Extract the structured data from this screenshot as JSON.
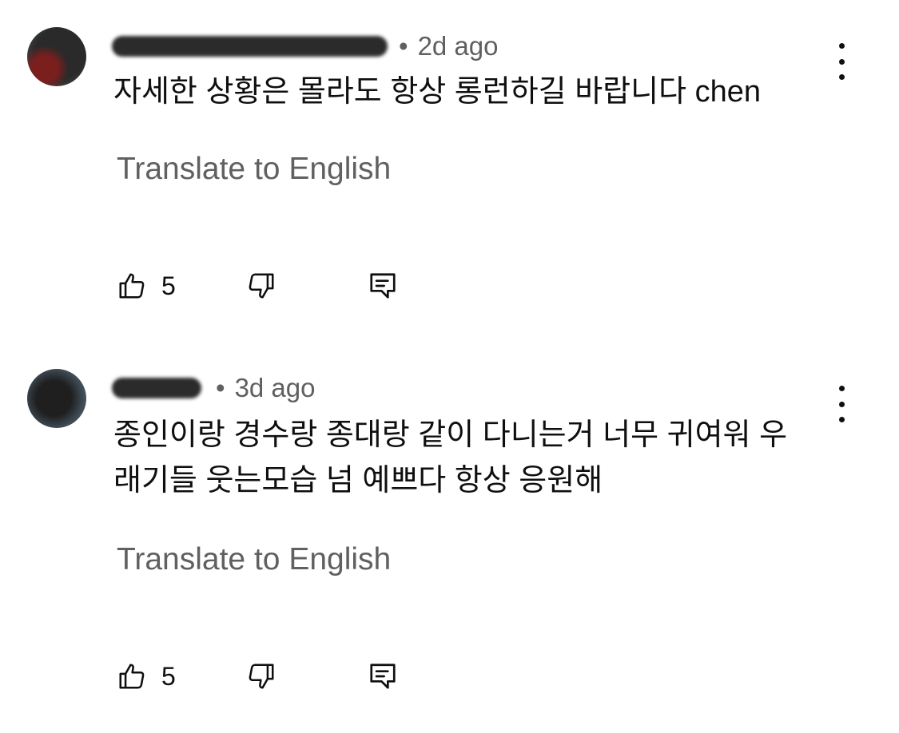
{
  "comments": [
    {
      "author": "",
      "time": "2d ago",
      "text": "자세한 상황은 몰라도 항상 롱런하길 바랍니다 chen",
      "translate_label": "Translate to English",
      "likes": "5"
    },
    {
      "author": "",
      "time": "3d ago",
      "text": "종인이랑 경수랑 종대랑 같이 다니는거 너무 귀여워 우\n래기들 웃는모습 넘 예쁘다 항상 응원해",
      "translate_label": "Translate to English",
      "likes": "5"
    }
  ],
  "separator": "•",
  "icons": {
    "like": "thumbs-up-icon",
    "dislike": "thumbs-down-icon",
    "reply": "reply-icon",
    "more": "more-vert-icon"
  },
  "colors": {
    "text": "#0f0f0f",
    "secondary": "#606060"
  }
}
